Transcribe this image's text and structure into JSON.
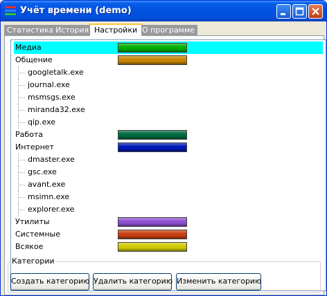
{
  "window": {
    "title": "Учёт времени (demo)",
    "app_icon": "app-bars-icon",
    "controls": [
      "minimize-icon",
      "maximize-icon",
      "close-icon"
    ]
  },
  "tabs": [
    {
      "label": "Статистика",
      "active": false
    },
    {
      "label": "История",
      "active": false
    },
    {
      "label": "Настройки",
      "active": true
    },
    {
      "label": "О программе",
      "active": false
    }
  ],
  "tree": {
    "rows": [
      {
        "label": "Медиа",
        "type": "category",
        "color": "#00b000",
        "selected": true
      },
      {
        "label": "Общение",
        "type": "category",
        "color": "#c88400"
      },
      {
        "label": "googletalk.exe",
        "type": "process"
      },
      {
        "label": "journal.exe",
        "type": "process"
      },
      {
        "label": "msmsgs.exe",
        "type": "process"
      },
      {
        "label": "miranda32.exe",
        "type": "process"
      },
      {
        "label": "qip.exe",
        "type": "process"
      },
      {
        "label": "Работа",
        "type": "category",
        "color": "#006a40"
      },
      {
        "label": "Интернет",
        "type": "category",
        "color": "#0018b8"
      },
      {
        "label": "dmaster.exe",
        "type": "process"
      },
      {
        "label": "gsc.exe",
        "type": "process"
      },
      {
        "label": "avant.exe",
        "type": "process"
      },
      {
        "label": "msimn.exe",
        "type": "process"
      },
      {
        "label": "explorer.exe",
        "type": "process"
      },
      {
        "label": "Утилиты",
        "type": "category",
        "color": "#9050d0"
      },
      {
        "label": "Системные",
        "type": "category",
        "color": "#c84010"
      },
      {
        "label": "Всякое",
        "type": "category",
        "color": "#d0c800"
      }
    ]
  },
  "categories_group": {
    "legend": "Категории",
    "buttons": [
      "Создать категорию",
      "Удалить категорию",
      "Изменить категорию"
    ]
  }
}
